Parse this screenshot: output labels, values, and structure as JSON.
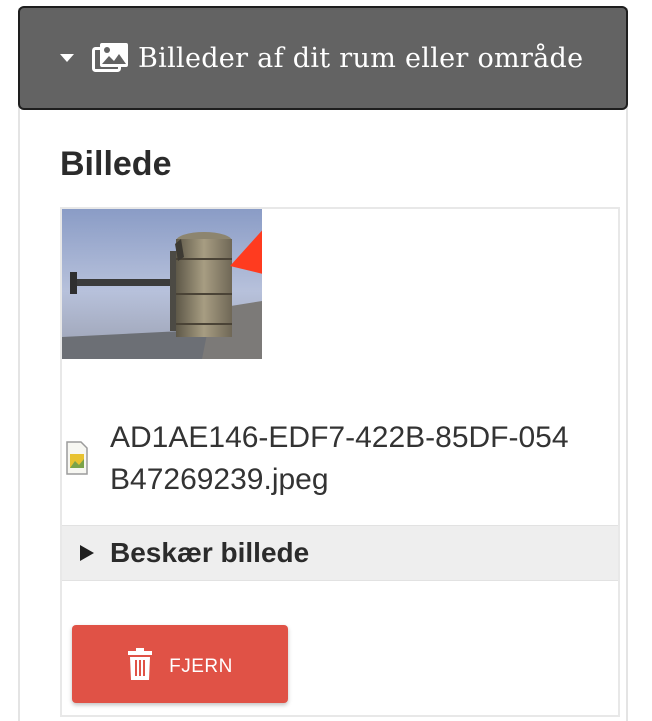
{
  "section": {
    "title": "Billeder af dit rum eller område",
    "expanded_icon": "caret-down-icon",
    "icon": "images-icon"
  },
  "field": {
    "label": "Billede"
  },
  "image": {
    "alt": "",
    "file_icon": "image-file-icon",
    "filename": "AD1AE146-EDF7-422B-85DF-054B47269239.jpeg"
  },
  "crop": {
    "label": "Beskær billede",
    "icon": "triangle-right-icon"
  },
  "remove_button": {
    "label": "FJERN",
    "icon": "trash-icon",
    "color": "#e05246"
  },
  "colors": {
    "header_bg": "#636363",
    "annotation_arrow": "#ff3b1f"
  }
}
